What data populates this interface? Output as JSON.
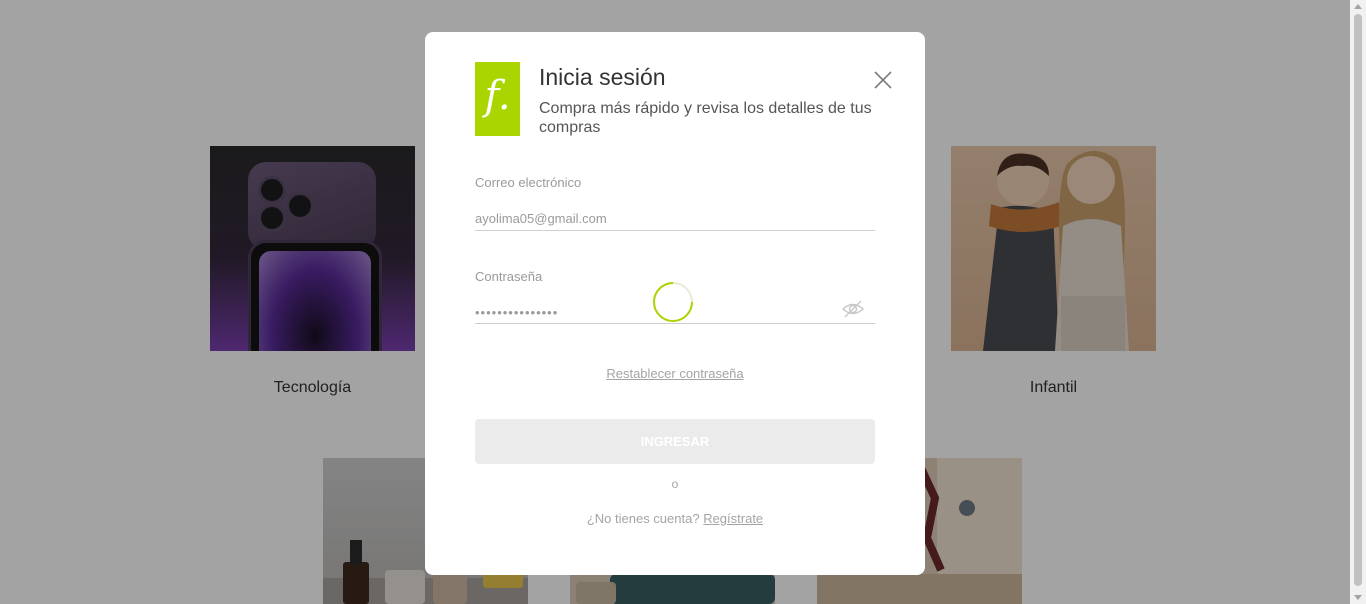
{
  "categories": [
    {
      "label": "Tecnología",
      "image": "iphone-purple"
    },
    {
      "label": "Infantil",
      "image": "kids-smiling"
    }
  ],
  "bottom_images": [
    "beauty-products",
    "living-room-sofa",
    "window-room"
  ],
  "modal": {
    "logo": "f.",
    "title": "Inicia sesión",
    "subtitle": "Compra más rápido y revisa los detalles de tus compras",
    "email": {
      "label": "Correo electrónico",
      "value": "ayolima05@gmail.com"
    },
    "password": {
      "label": "Contraseña",
      "value": "•••••••••••••••"
    },
    "reset_link": "Restablecer contraseña",
    "submit_label": "INGRESAR",
    "or_text": "o",
    "signup_prompt": "¿No tienes cuenta?",
    "signup_link": "Regístrate",
    "close_icon": "close-icon",
    "eye_icon": "eye-off-icon"
  },
  "colors": {
    "brand": "#aad500",
    "button_disabled": "#ebebeb",
    "spinner": "#aad500",
    "overlay": "#a3a3a3"
  }
}
